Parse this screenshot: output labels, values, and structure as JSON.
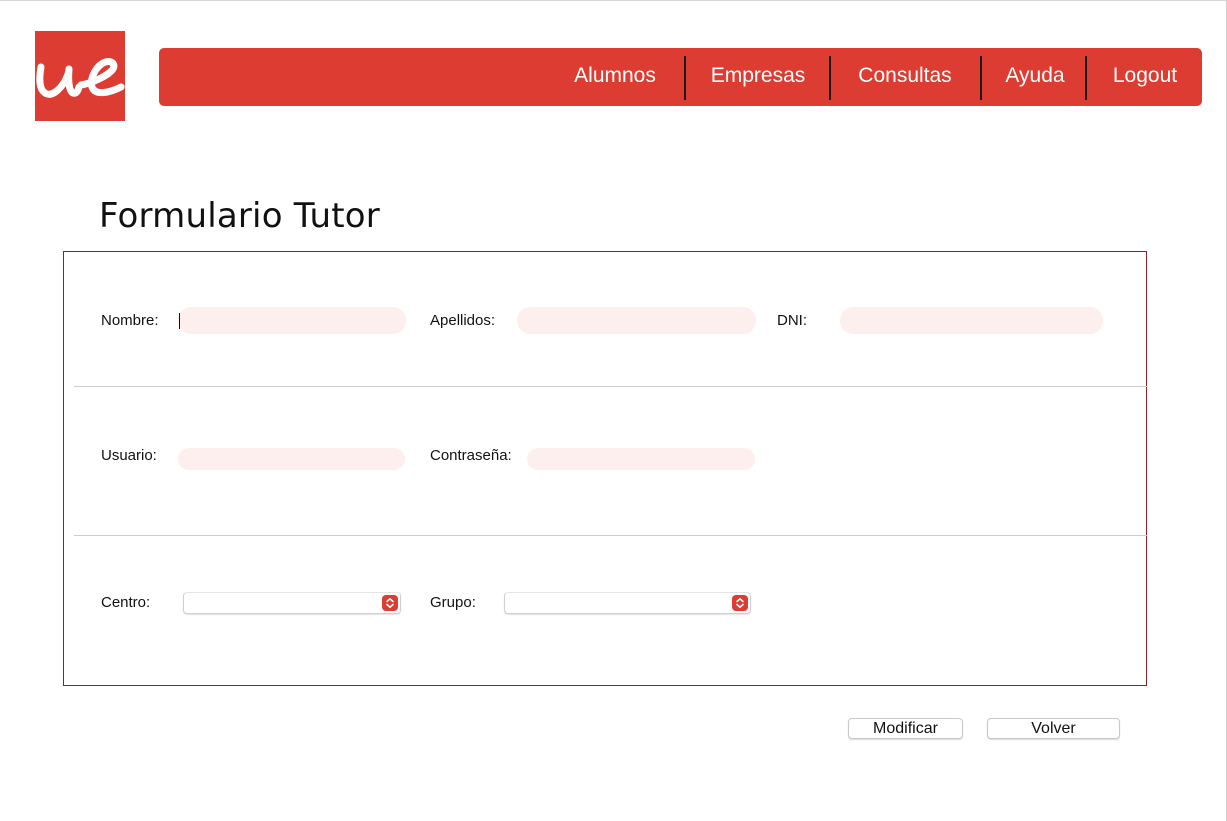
{
  "brand": {
    "logo_text": "ue",
    "color": "#dc3c31"
  },
  "nav": {
    "items": [
      {
        "label": "Alumnos"
      },
      {
        "label": "Empresas"
      },
      {
        "label": "Consultas"
      },
      {
        "label": "Ayuda"
      },
      {
        "label": "Logout"
      }
    ]
  },
  "page": {
    "title": "Formulario Tutor"
  },
  "form": {
    "nombre": {
      "label": "Nombre:",
      "value": ""
    },
    "apellidos": {
      "label": "Apellidos:",
      "value": ""
    },
    "dni": {
      "label": "DNI:",
      "value": ""
    },
    "usuario": {
      "label": "Usuario:",
      "value": ""
    },
    "contrasena": {
      "label": "Contraseña:",
      "value": ""
    },
    "centro": {
      "label": "Centro:",
      "selected": ""
    },
    "grupo": {
      "label": "Grupo:",
      "selected": ""
    },
    "border_color": "#8e1c2b",
    "field_color": "#fdefed"
  },
  "actions": {
    "modify_label": "Modificar",
    "back_label": "Volver"
  }
}
